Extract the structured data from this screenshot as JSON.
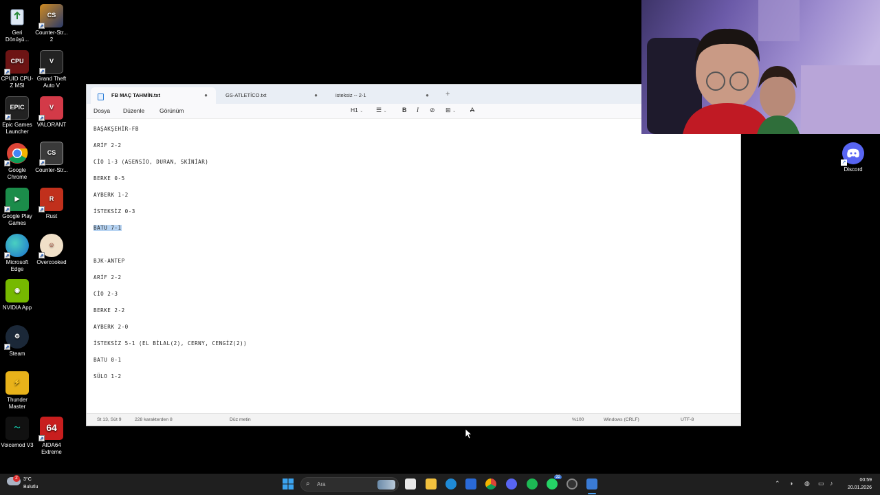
{
  "desktop": {
    "icons": [
      {
        "label": "Geri Dönüşü...",
        "icon": "recycle-bin-icon"
      },
      {
        "label": "Counter-Str... 2",
        "icon": "cs2-icon"
      },
      {
        "label": "CPUID CPU-Z MSI",
        "icon": "cpuz-icon"
      },
      {
        "label": "Grand Theft Auto V",
        "icon": "gta-icon"
      },
      {
        "label": "Epic Games Launcher",
        "icon": "epic-icon"
      },
      {
        "label": "VALORANT",
        "icon": "valorant-icon"
      },
      {
        "label": "Google Chrome",
        "icon": "chrome-icon"
      },
      {
        "label": "Counter-Str...",
        "icon": "csgo-icon"
      },
      {
        "label": "Google Play Games",
        "icon": "google-play-games-icon"
      },
      {
        "label": "Rust",
        "icon": "rust-icon"
      },
      {
        "label": "Microsoft Edge",
        "icon": "edge-icon"
      },
      {
        "label": "Overcooked",
        "icon": "overcooked-icon"
      },
      {
        "label": "NVIDIA App",
        "icon": "nvidia-icon"
      },
      {
        "label": "Steam",
        "icon": "steam-icon"
      },
      {
        "label": "Thunder Master",
        "icon": "thunder-master-icon"
      },
      {
        "label": "Voicemod V3",
        "icon": "voicemod-icon"
      },
      {
        "label": "AIDA64 Extreme",
        "icon": "aida64-icon"
      }
    ],
    "right_icon": {
      "label": "Discord",
      "icon": "discord-icon"
    }
  },
  "notepad": {
    "tabs": [
      {
        "title": "FB MAÇ TAHMİN.txt",
        "active": true
      },
      {
        "title": "GS-ATLETİCO.txt",
        "active": false
      },
      {
        "title": "isteksiz -- 2-1",
        "active": false
      }
    ],
    "menu": [
      "Dosya",
      "Düzenle",
      "Görünüm"
    ],
    "toolbar": {
      "heading": "H1"
    },
    "lines": [
      "BAŞAKŞEHİR-FB",
      "ARİF 2-2",
      "CİO 1-3 (ASENSİO, DURAN, SKİNİAR)",
      "BERKE 0-5",
      "AYBERK 1-2",
      "İSTEKSİZ 0-3",
      "BATU 7-1",
      "",
      "BJK-ANTEP",
      "ARİF 2-2",
      "CİO 2-3",
      "BERKE 2-2",
      "AYBERK 2-0",
      "İSTEKSİZ 5-1 (EL BİLAL(2), CERNY, CENGİZ(2))",
      "BATU 0-1",
      "SÜLO 1-2"
    ],
    "selected_line": 6,
    "status": {
      "position": "St 13, Süt 9",
      "chars": "228 karakterden 8",
      "format": "Düz metin",
      "zoom": "%100",
      "line_ending": "Windows (CRLF)",
      "encoding": "UTF-8"
    }
  },
  "taskbar": {
    "weather": {
      "temp": "3°C",
      "desc": "Bulutlu",
      "badge": "2"
    },
    "search_placeholder": "Ara",
    "clock": {
      "time": "00:59",
      "date": "20.01.2026"
    },
    "whatsapp_badge": "32"
  },
  "colors": {
    "selection": "#b6d3f2",
    "discord": "#5865f2",
    "taskbar": "#1f1f1f"
  }
}
